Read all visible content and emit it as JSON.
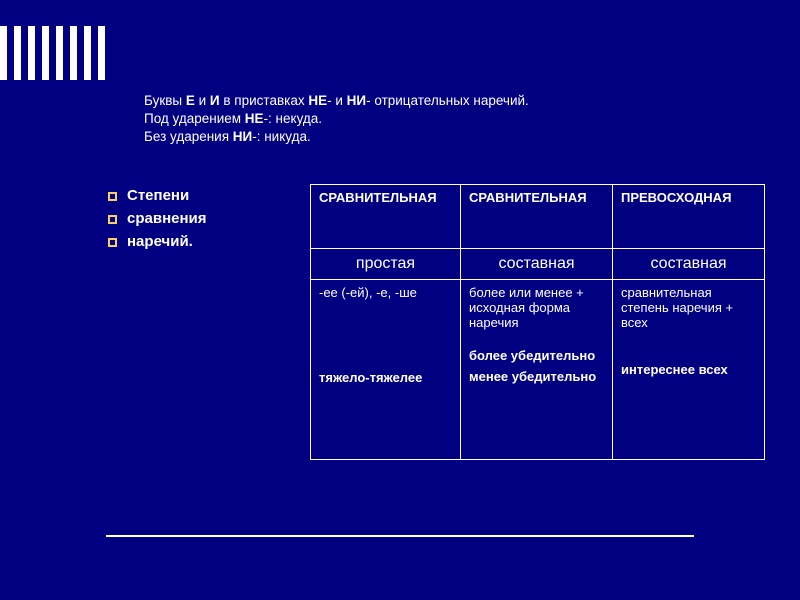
{
  "title": {
    "line1_pre": "Буквы ",
    "line1_b1": "Е",
    "line1_mid1": " и ",
    "line1_b2": "И",
    "line1_mid2": " в приставках ",
    "line1_b3": "НЕ",
    "line1_mid3": "- и ",
    "line1_b4": "НИ",
    "line1_post": "- отрицательных наречий.",
    "line2_pre": "Под ударением ",
    "line2_b": "НЕ",
    "line2_post": "-: некуда.",
    "line3_pre": "Без ударения ",
    "line3_b": "НИ",
    "line3_post": "-: никуда."
  },
  "bullets": {
    "b1": "Степени",
    "b2": "сравнения",
    "b3": "наречий."
  },
  "table": {
    "header": {
      "c1": "СРАВНИТЕЛЬНАЯ",
      "c2": "СРАВНИТЕЛЬНАЯ",
      "c3": "ПРЕВОСХОДНАЯ"
    },
    "sub": {
      "c1": "простая",
      "c2": "составная",
      "c3": "составная"
    },
    "body": {
      "c1_top": "-ее (-ей), -е, -ше",
      "c1_ex": "тяжело-тяжелее",
      "c2_top": "более или менее + исходная форма наречия",
      "c2_ex1": "более убедительно",
      "c2_ex2": "менее убедительно",
      "c3_top": "сравнительная степень наречия + всех",
      "c3_ex": "интереснее всех"
    }
  }
}
